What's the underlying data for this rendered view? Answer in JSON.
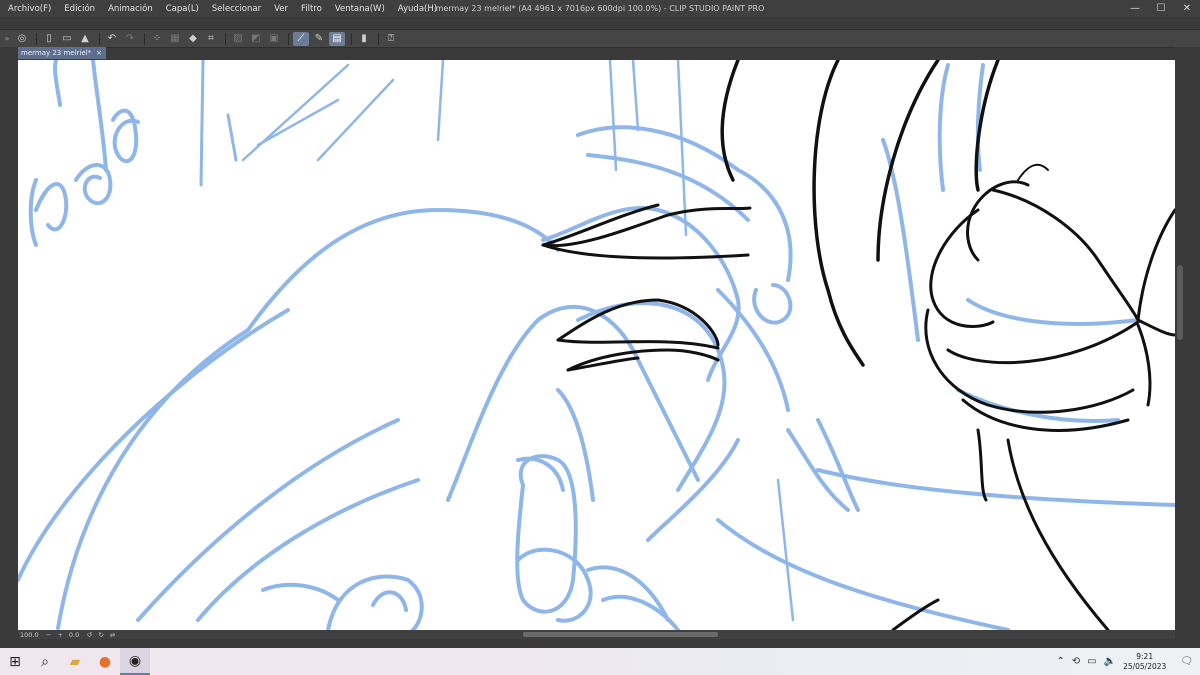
{
  "window": {
    "title": "mermay 23 melriel* (A4 4961 x 7016px 600dpi 100.0%)  - CLIP STUDIO PAINT PRO",
    "controls": {
      "minimize": "—",
      "maximize": "☐",
      "close": "✕"
    }
  },
  "menu": {
    "items": [
      "Archivo(F)",
      "Edición",
      "Animación",
      "Capa(L)",
      "Seleccionar",
      "Ver",
      "Filtro",
      "Ventana(W)",
      "Ayuda(H)"
    ]
  },
  "toolbar": {
    "icons": [
      "clip-studio-icon",
      "new-icon",
      "open-icon",
      "save-icon",
      "undo-icon",
      "redo-icon",
      "select-all-icon",
      "deselect-icon",
      "fill-icon",
      "transform-icon",
      "pen-icon",
      "brush-icon",
      "ruler-icon",
      "snap-icon",
      "layer-icon",
      "tablet-icon",
      "help-icon"
    ]
  },
  "document_tab": {
    "label": "mermay 23 melriel*",
    "close": "×"
  },
  "statusbar": {
    "zoom": "100.0",
    "zoom_minus": "−",
    "zoom_plus": "+",
    "angle": "0.0"
  },
  "taskbar": {
    "time": "9:21",
    "date": "25/05/2023"
  },
  "colors": {
    "sketch_blue": "#8fb6e8",
    "ink_black": "#111111",
    "tab_active": "#5d6f8d"
  }
}
